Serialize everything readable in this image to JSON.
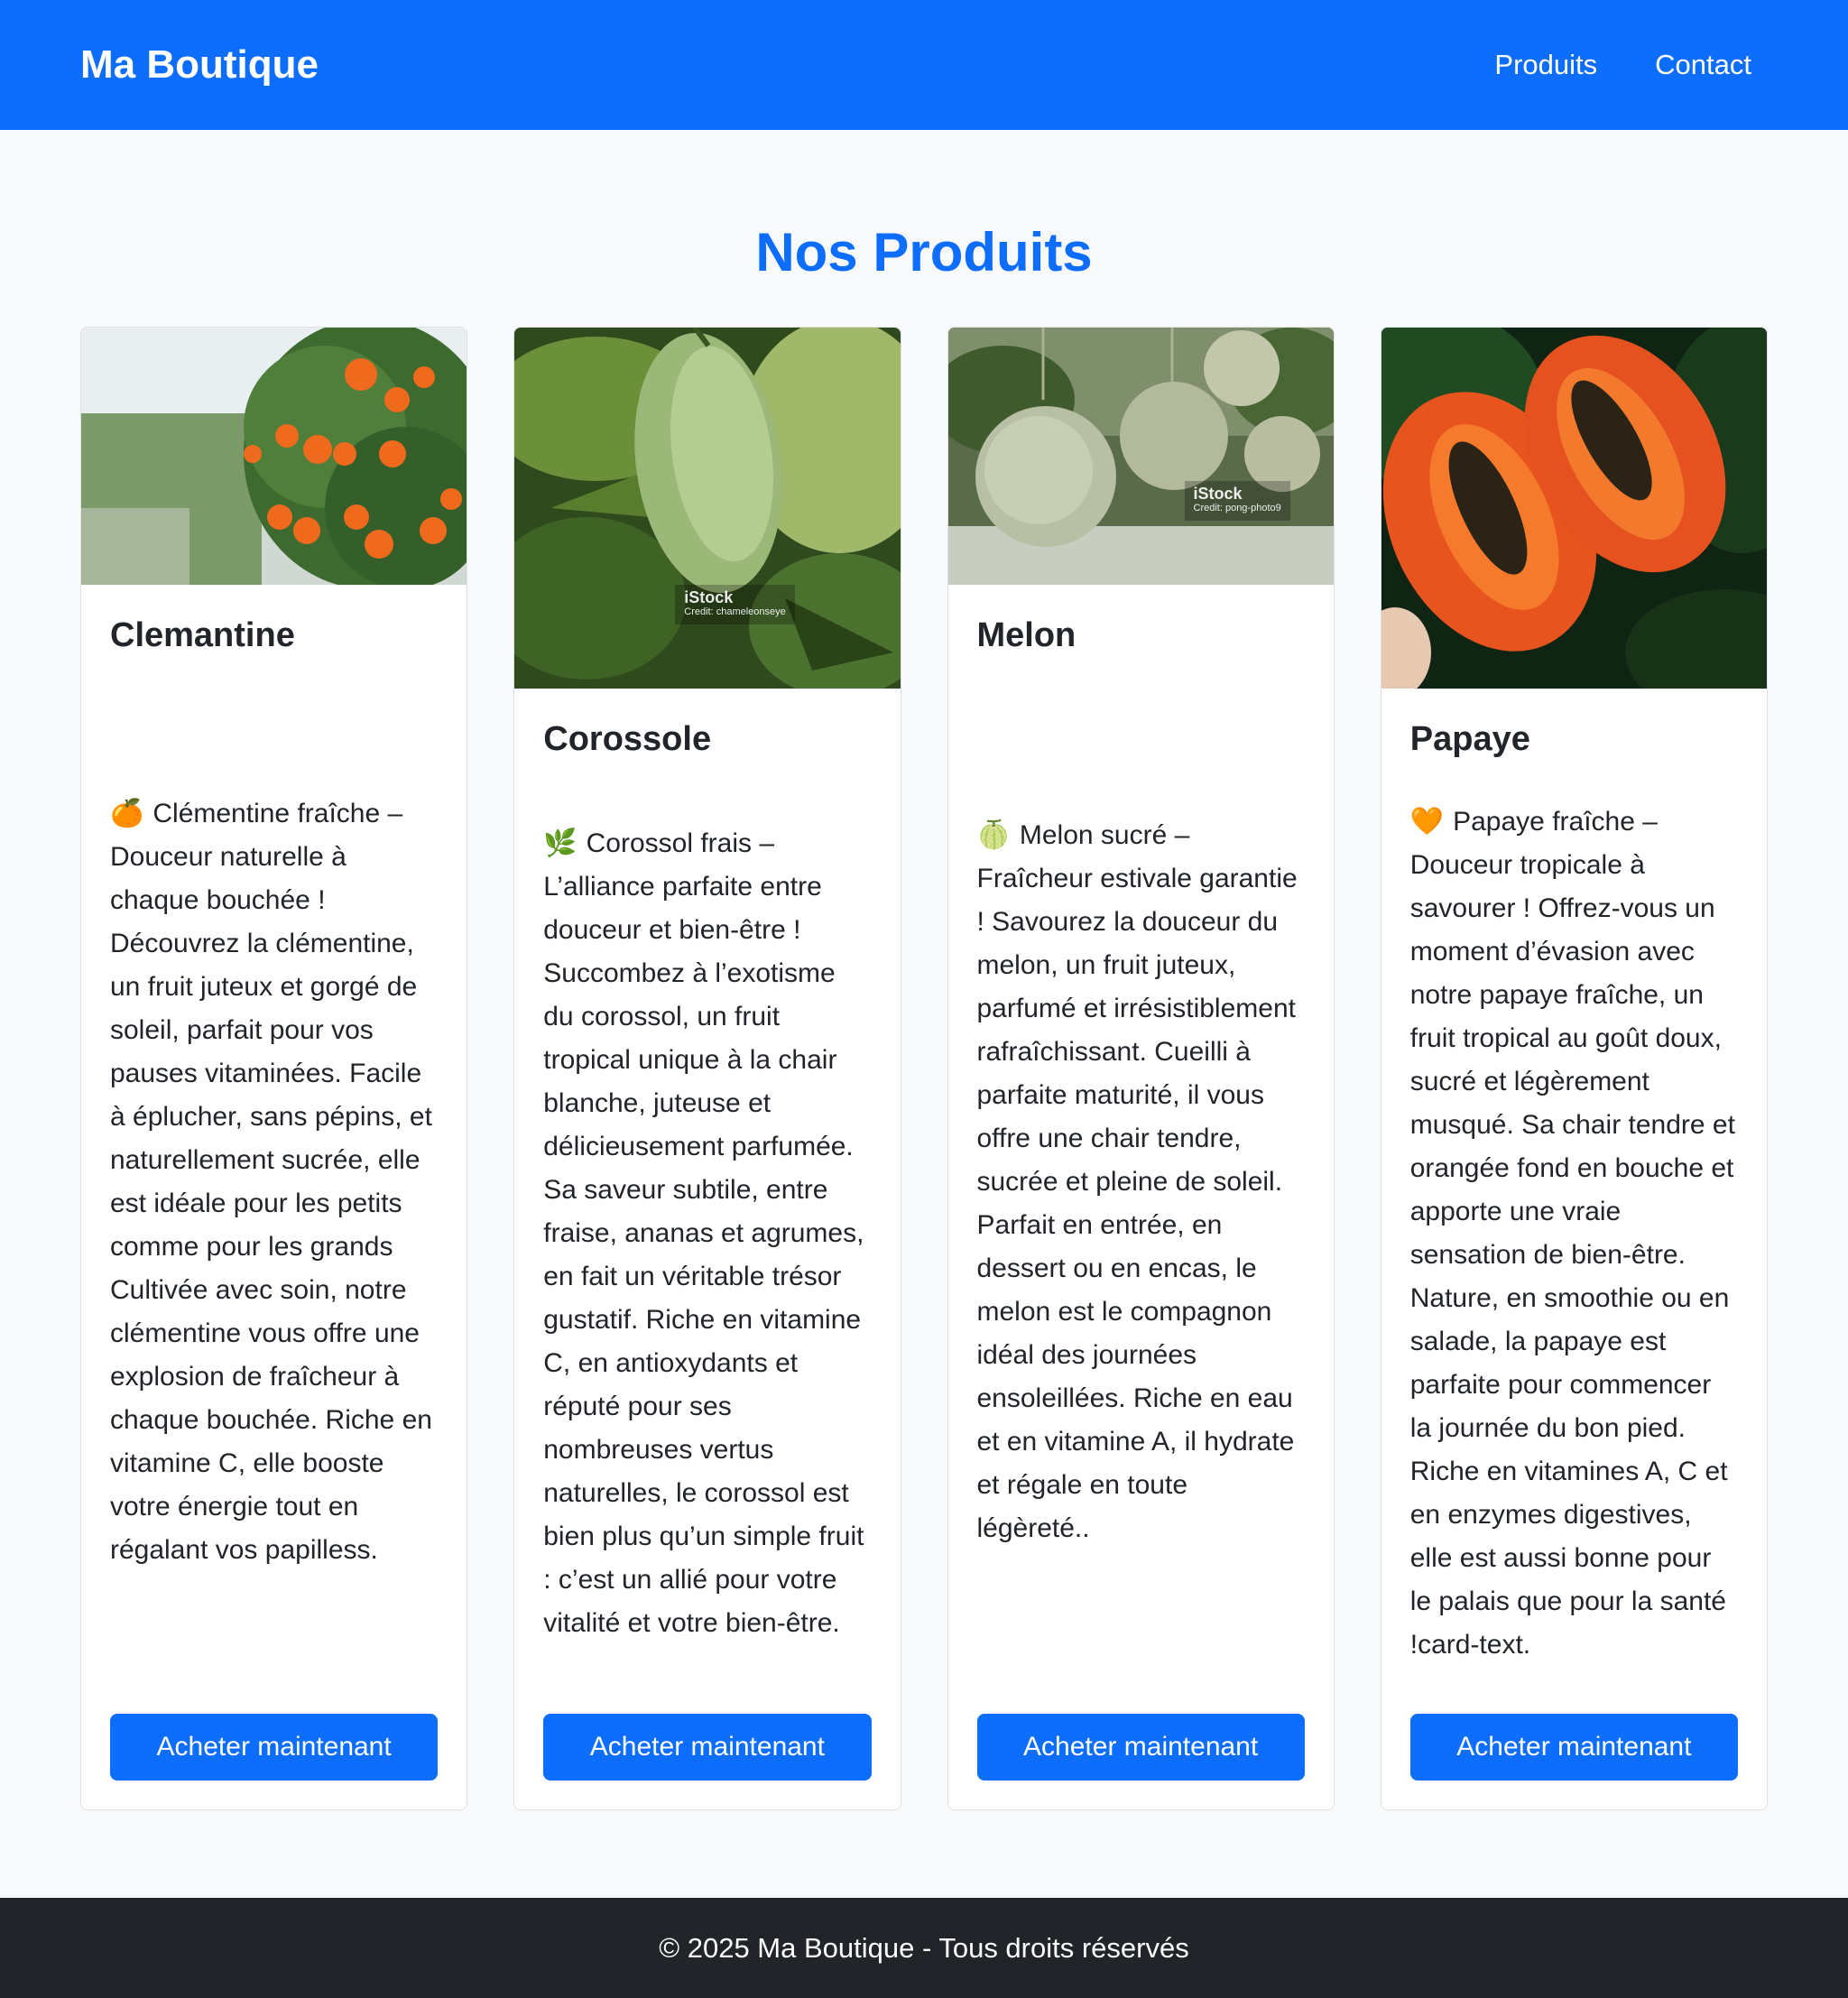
{
  "navbar": {
    "brand": "Ma Boutique",
    "links": [
      "Produits",
      "Contact"
    ]
  },
  "main": {
    "title": "Nos Produits"
  },
  "products": [
    {
      "name": "Clemantine",
      "emoji": "🍊",
      "description": "Clémentine fraîche – Douceur naturelle à chaque bouchée ! Découvrez la clémentine, un fruit juteux et gorgé de soleil, parfait pour vos pauses vitaminées. Facile à éplucher, sans pépins, et naturellement sucrée, elle est idéale pour les petits comme pour les grands Cultivée avec soin, notre clémentine vous offre une explosion de fraîcheur à chaque bouchée. Riche en vitamine C, elle booste votre énergie tout en régalant vos papilless.",
      "button": "Acheter maintenant",
      "image": "clementine-tree-photo"
    },
    {
      "name": "Corossole",
      "emoji": "🌿",
      "description": "Corossol frais – L’alliance parfaite entre douceur et bien-être ! Succombez à l’exotisme du corossol, un fruit tropical unique à la chair blanche, juteuse et délicieusement parfumée. Sa saveur subtile, entre fraise, ananas et agrumes, en fait un véritable trésor gustatif. Riche en vitamine C, en antioxydants et réputé pour ses nombreuses vertus naturelles, le corossol est bien plus qu’un simple fruit : c’est un allié pour votre vitalité et votre bien-être.",
      "button": "Acheter maintenant",
      "image": "soursop-photo",
      "watermark": "iStock",
      "credit": "Credit: chameleonseye"
    },
    {
      "name": "Melon",
      "emoji": "🍈",
      "description": "Melon sucré – Fraîcheur estivale garantie ! Savourez la douceur du melon, un fruit juteux, parfumé et irrésistiblement rafraîchissant. Cueilli à parfaite maturité, il vous offre une chair tendre, sucrée et pleine de soleil. Parfait en entrée, en dessert ou en encas, le melon est le compagnon idéal des journées ensoleillées. Riche en eau et en vitamine A, il hydrate et régale en toute légèreté..",
      "button": "Acheter maintenant",
      "image": "melon-photo",
      "watermark": "iStock",
      "credit": "Credit: pong-photo9"
    },
    {
      "name": "Papaye",
      "emoji": "🧡",
      "description": "Papaye fraîche – Douceur tropicale à savourer ! Offrez-vous un moment d’évasion avec notre papaye fraîche, un fruit tropical au goût doux, sucré et légèrement musqué. Sa chair tendre et orangée fond en bouche et apporte une vraie sensation de bien-être. Nature, en smoothie ou en salade, la papaye est parfaite pour commencer la journée du bon pied. Riche en vitamines A, C et en enzymes digestives, elle est aussi bonne pour le palais que pour la santé !card-text.",
      "button": "Acheter maintenant",
      "image": "papaya-photo"
    }
  ],
  "footer": {
    "text": "© 2025 Ma Boutique - Tous droits réservés"
  },
  "colors": {
    "primary": "#0d6efd",
    "footer_bg": "#212529",
    "page_bg": "#f8f9fa"
  }
}
